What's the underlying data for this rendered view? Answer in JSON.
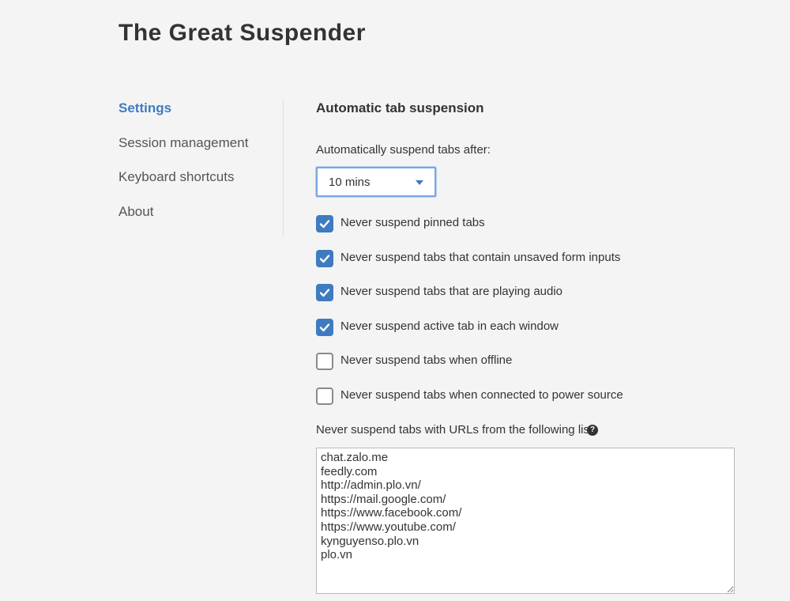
{
  "app": {
    "title": "The Great Suspender"
  },
  "nav": {
    "items": [
      {
        "label": "Settings",
        "active": true
      },
      {
        "label": "Session management",
        "active": false
      },
      {
        "label": "Keyboard shortcuts",
        "active": false
      },
      {
        "label": "About",
        "active": false
      }
    ]
  },
  "settings": {
    "section_title": "Automatic tab suspension",
    "suspend_after_label": "Automatically suspend tabs after:",
    "suspend_after_value": "10 mins",
    "options": [
      {
        "label": "Never suspend pinned tabs",
        "checked": true
      },
      {
        "label": "Never suspend tabs that contain unsaved form inputs",
        "checked": true
      },
      {
        "label": "Never suspend tabs that are playing audio",
        "checked": true
      },
      {
        "label": "Never suspend active tab in each window",
        "checked": true
      },
      {
        "label": "Never suspend tabs when offline",
        "checked": false
      },
      {
        "label": "Never suspend tabs when connected to power source",
        "checked": false
      }
    ],
    "whitelist_label": "Never suspend tabs with URLs from the following list:",
    "help_icon_glyph": "?",
    "whitelist_value": "chat.zalo.me\nfeedly.com\nhttp://admin.plo.vn/\nhttps://mail.google.com/\nhttps://www.facebook.com/\nhttps://www.youtube.com/\nkynguyenso.plo.vn\nplo.vn"
  },
  "colors": {
    "accent": "#3f7bc0",
    "background": "#f4f4f4",
    "text": "#333333"
  }
}
